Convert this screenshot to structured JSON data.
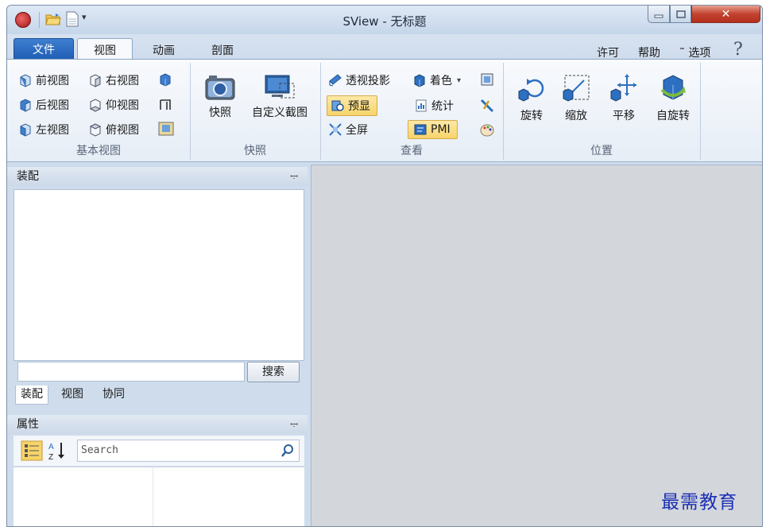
{
  "window": {
    "title": "SView - 无标题"
  },
  "tabs": {
    "file": "文件",
    "view": "视图",
    "animation": "动画",
    "section": "剖面",
    "license": "许可",
    "help": "帮助",
    "options": "˜ 选项"
  },
  "ribbon": {
    "basic_views": {
      "label": "基本视图",
      "front": "前视图",
      "right": "右视图",
      "back": "后视图",
      "bottom": "仰视图",
      "left": "左视图",
      "top": "俯视图"
    },
    "snapshot": {
      "label": "快照",
      "snapshot": "快照",
      "custom_capture": "自定义截图"
    },
    "look": {
      "label": "查看",
      "perspective": "透视投影",
      "shading": "着色",
      "preview": "预显",
      "statistics": "统计",
      "fullscreen": "全屏",
      "pmi": "PMI"
    },
    "position": {
      "label": "位置",
      "rotate": "旋转",
      "zoom": "缩放",
      "pan": "平移",
      "auto_rotate": "自旋转"
    }
  },
  "assembly_panel": {
    "title": "装配",
    "search_button": "搜索",
    "search_value": ""
  },
  "bottom_tabs": [
    "装配",
    "视图",
    "协同"
  ],
  "properties_panel": {
    "title": "属性",
    "search_placeholder": "Search"
  },
  "watermark": "最需教育",
  "colors": {
    "file_tab": "#1f5db6",
    "highlight": "#f7d46a",
    "close_button": "#c24430",
    "viewport": "#d3d6db"
  }
}
